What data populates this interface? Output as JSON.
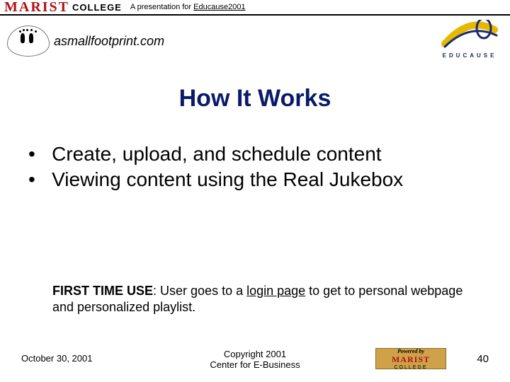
{
  "header": {
    "org_name": "MARIST",
    "org_sub": "COLLEGE",
    "tagline_prefix": "A presentation for ",
    "tagline_event": "Educause",
    "tagline_year": "2001"
  },
  "logos": {
    "footprint_text": "asmallfootprint.com",
    "educause_label": "EDUCAUSE"
  },
  "title": "How It Works",
  "bullets": [
    "Create, upload, and schedule content",
    "Viewing content using the Real Jukebox"
  ],
  "note": {
    "lead": "FIRST TIME USE",
    "sep": ":  ",
    "before_link": "User goes to a ",
    "link_text": "login page",
    "after_link": " to get to personal webpage and personalized playlist."
  },
  "footer": {
    "date": "October 30, 2001",
    "copyright_line1": "Copyright 2001",
    "copyright_line2": "Center for E-Business",
    "badge_powered": "Powered by",
    "badge_marist": "MARIST",
    "badge_college": "COLLEGE",
    "page_number": "40"
  }
}
